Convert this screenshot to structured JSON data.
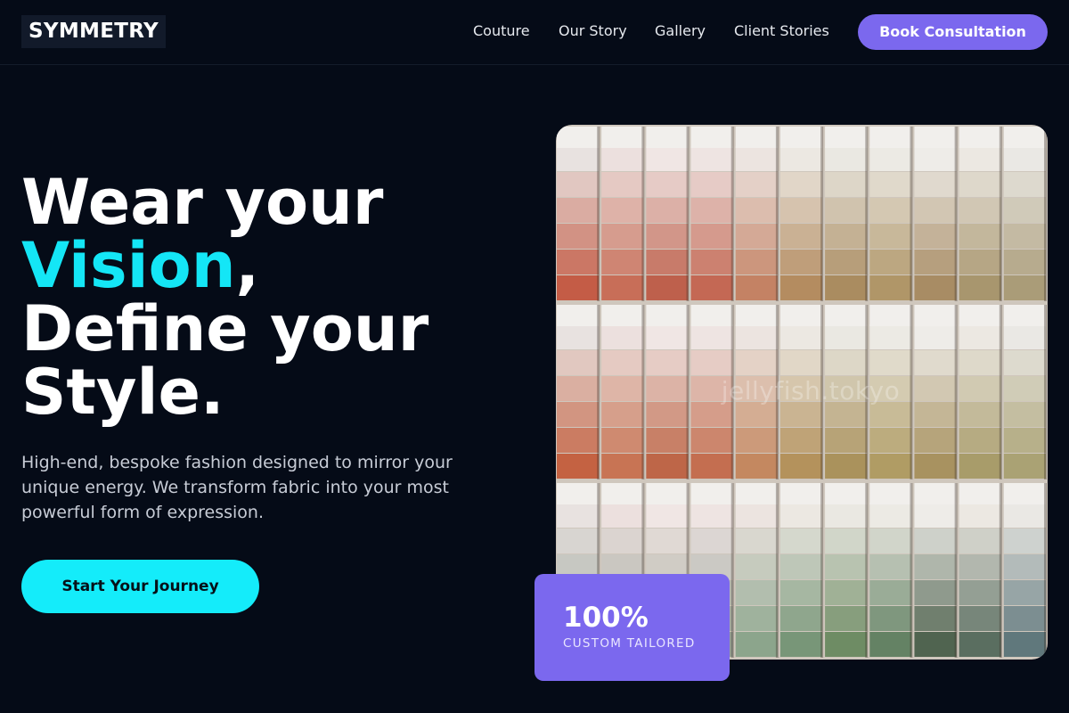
{
  "brand": {
    "logo": "SYMMETRY"
  },
  "nav": {
    "items": [
      {
        "label": "Couture"
      },
      {
        "label": "Our Story"
      },
      {
        "label": "Gallery"
      },
      {
        "label": "Client Stories"
      }
    ],
    "cta_label": "Book Consultation"
  },
  "hero": {
    "title_line1": "Wear your",
    "title_accent": "Vision",
    "title_comma": ",",
    "title_line3": "Define your",
    "title_line4": "Style.",
    "subtitle": "High-end, bespoke fashion designed to mirror your unique energy. We transform fabric into your most powerful form of expression.",
    "cta_label": "Start Your Journey"
  },
  "image": {
    "watermark": "jellyfish.tokyo"
  },
  "stat": {
    "value": "100%",
    "label": "CUSTOM TAILORED"
  },
  "colors": {
    "background": "#050b17",
    "accent_cyan": "#14e6f6",
    "accent_violet": "#7b68ee"
  }
}
